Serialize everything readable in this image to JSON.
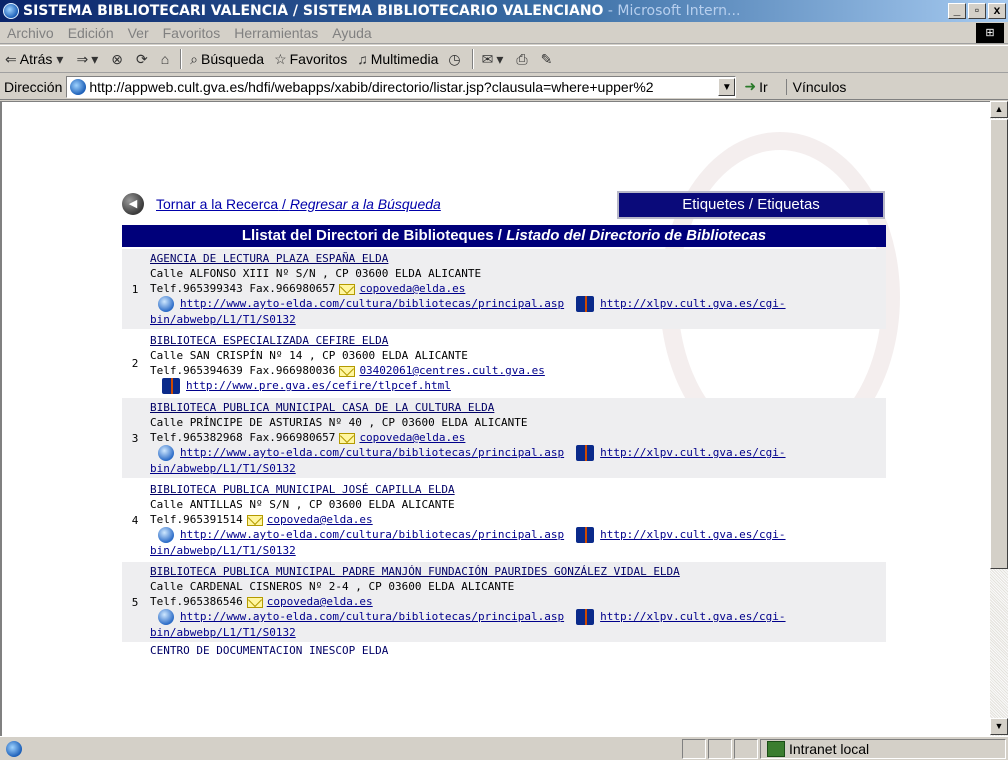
{
  "window": {
    "title": "SISTEMA BIBLIOTECARI VALENCIÀ / SISTEMA BIBLIOTECARIO VALENCIANO",
    "title_suffix": " - Microsoft Intern...",
    "minimize": "_",
    "maximize": "▫",
    "close": "x"
  },
  "menu": [
    "Archivo",
    "Edición",
    "Ver",
    "Favoritos",
    "Herramientas",
    "Ayuda"
  ],
  "toolbar": {
    "back": "Atrás",
    "search": "Búsqueda",
    "favorites": "Favoritos",
    "multimedia": "Multimedia"
  },
  "address": {
    "label": "Dirección",
    "url": "http://appweb.cult.gva.es/hdfi/webapps/xabib/directorio/listar.jsp?clausula=where+upper%2",
    "go": "Ir",
    "links": "Vínculos"
  },
  "nav": {
    "back_link_va": "Tornar a la Recerca",
    "back_link_sep": " / ",
    "back_link_es": "Regresar a la Búsqueda",
    "tags_button": "Etiquetes / Etiquetas"
  },
  "list_header": {
    "va": "Llistat del Directori de Biblioteques",
    "sep": " / ",
    "es": "Listado del Directorio de Bibliotecas"
  },
  "entries": [
    {
      "num": "1",
      "name": "AGENCIA DE LECTURA PLAZA ESPAÑA ELDA",
      "address": "Calle ALFONSO XIII Nº S/N , CP 03600 ELDA ALICANTE",
      "phone": "Telf.965399343 Fax.966980657",
      "email": "copoveda@elda.es",
      "web": "http://www.ayto-elda.com/cultura/bibliotecas/principal.asp",
      "xlpv1": "http://xlpv.cult.gva.es/cgi-",
      "xlpv2": "bin/abwebp/L1/T1/S0132"
    },
    {
      "num": "2",
      "name": "BIBLIOTECA ESPECIALIZADA CEFIRE ELDA",
      "address": "Calle SAN CRISPÍN Nº 14 , CP 03600 ELDA ALICANTE",
      "phone": "Telf.965394639 Fax.966980036",
      "email": "03402061@centres.cult.gva.es",
      "web": "http://www.pre.gva.es/cefire/tlpcef.html"
    },
    {
      "num": "3",
      "name": "BIBLIOTECA PUBLICA MUNICIPAL CASA DE LA CULTURA ELDA",
      "address": "Calle PRÍNCIPE DE ASTURIAS Nº 40 , CP 03600 ELDA ALICANTE",
      "phone": "Telf.965382968 Fax.966980657",
      "email": "copoveda@elda.es",
      "web": "http://www.ayto-elda.com/cultura/bibliotecas/principal.asp",
      "xlpv1": "http://xlpv.cult.gva.es/cgi-",
      "xlpv2": "bin/abwebp/L1/T1/S0132"
    },
    {
      "num": "4",
      "name": "BIBLIOTECA PUBLICA MUNICIPAL JOSÉ CAPILLA ELDA",
      "address": "Calle ANTILLAS Nº S/N , CP 03600 ELDA ALICANTE",
      "phone": "Telf.965391514",
      "email": "copoveda@elda.es",
      "web": "http://www.ayto-elda.com/cultura/bibliotecas/principal.asp",
      "xlpv1": "http://xlpv.cult.gva.es/cgi-",
      "xlpv2": "bin/abwebp/L1/T1/S0132"
    },
    {
      "num": "5",
      "name": "BIBLIOTECA PUBLICA MUNICIPAL PADRE MANJÓN FUNDACIÓN PAURIDES GONZÁLEZ VIDAL ELDA",
      "address": "Calle CARDENAL CISNEROS Nº 2-4 , CP 03600 ELDA ALICANTE",
      "phone": "Telf.965386546",
      "email": "copoveda@elda.es",
      "web": "http://www.ayto-elda.com/cultura/bibliotecas/principal.asp",
      "xlpv1": "http://xlpv.cult.gva.es/cgi-",
      "xlpv2": "bin/abwebp/L1/T1/S0132"
    }
  ],
  "cut_entry": "CENTRO DE DOCUMENTACION INESCOP ELDA",
  "status": {
    "zone": "Intranet local"
  },
  "icons": {
    "back": "back-arrow-icon",
    "mail": "mail-icon",
    "web": "web-globe-icon",
    "xlpv": "xlpv-catalog-icon"
  }
}
